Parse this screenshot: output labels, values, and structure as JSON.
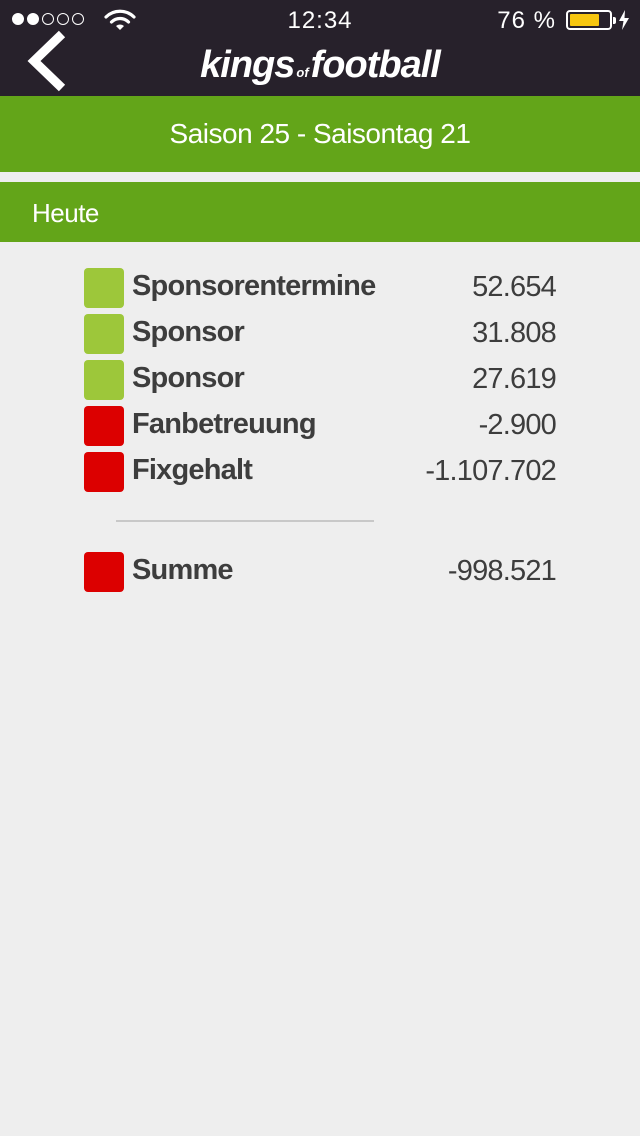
{
  "status_bar": {
    "time": "12:34",
    "battery_percent": "76 %",
    "battery_level": 0.76,
    "signal_bars_filled": 2,
    "signal_bars_total": 5,
    "colors": {
      "battery_fill": "#f6c610"
    }
  },
  "header": {
    "logo": {
      "part1": "kings",
      "part2": "of",
      "part3": "football"
    },
    "back_icon": "chevron-left-icon"
  },
  "season_bar": {
    "title": "Saison 25 - Saisontag 21"
  },
  "section": {
    "title": "Heute"
  },
  "items": [
    {
      "label": "Sponsorentermine",
      "value": "52.654",
      "status": "positive"
    },
    {
      "label": "Sponsor",
      "value": "31.808",
      "status": "positive"
    },
    {
      "label": "Sponsor",
      "value": "27.619",
      "status": "positive"
    },
    {
      "label": "Fanbetreuung",
      "value": "-2.900",
      "status": "negative"
    },
    {
      "label": "Fixgehalt",
      "value": "-1.107.702",
      "status": "negative"
    }
  ],
  "total": {
    "label": "Summe",
    "value": "-998.521",
    "status": "negative"
  },
  "colors": {
    "header_bg": "#27212b",
    "green_bar": "#63a519",
    "positive": "#9dc73a",
    "negative": "#dc0000",
    "background": "#eeeeee",
    "text": "#3d3d3d"
  }
}
